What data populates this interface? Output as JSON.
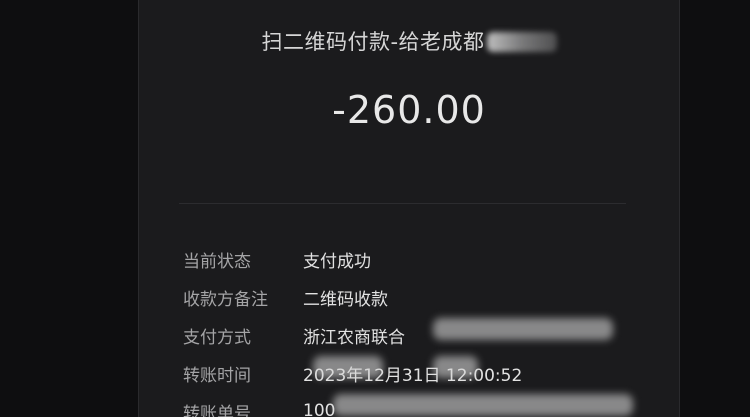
{
  "receipt": {
    "title": "扫二维码付款-给老成都",
    "amount": "-260.00",
    "details": [
      {
        "label": "当前状态",
        "value": "支付成功"
      },
      {
        "label": "收款方备注",
        "value": "二维码收款"
      },
      {
        "label": "支付方式",
        "value": "浙江农商联合"
      },
      {
        "label": "转账时间",
        "value": "2023年12月31日 12:00:52"
      },
      {
        "label": "转账单号",
        "value": "100"
      }
    ]
  }
}
